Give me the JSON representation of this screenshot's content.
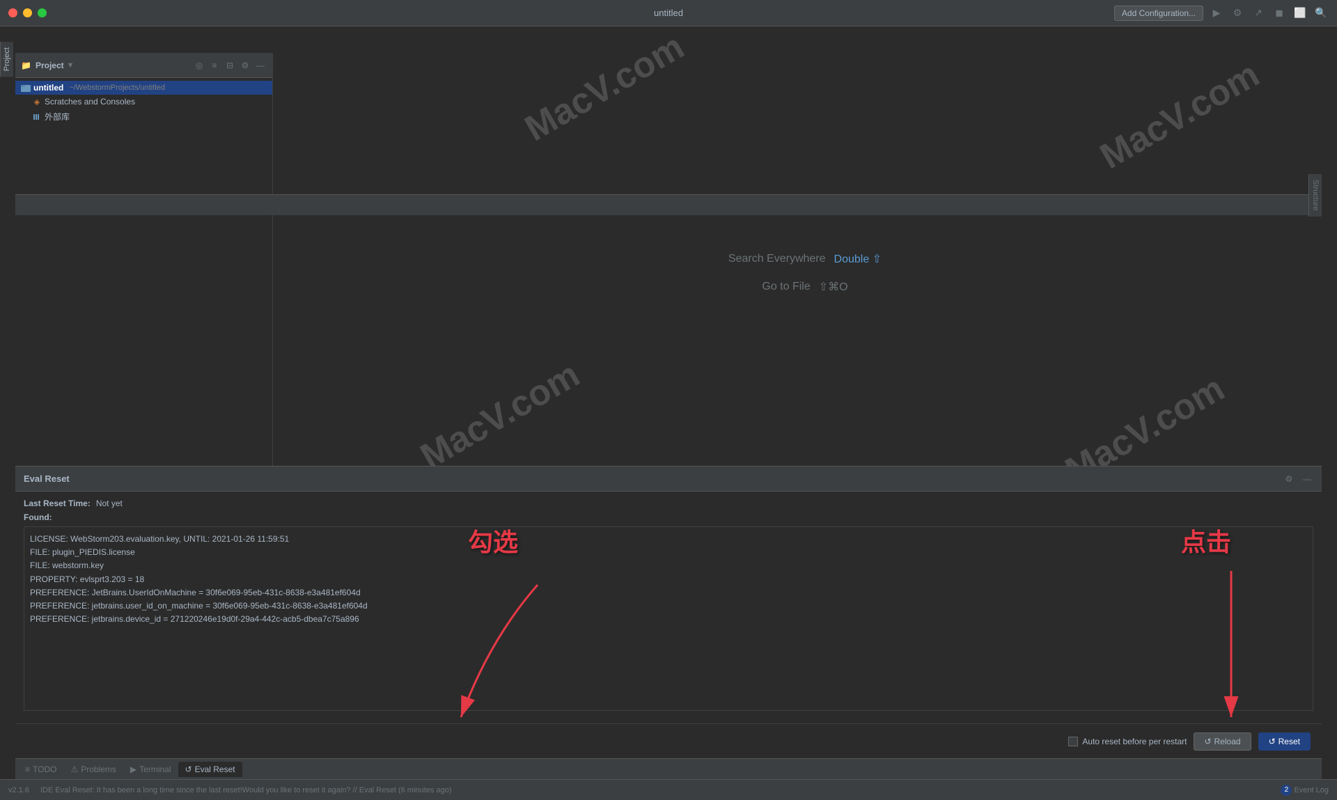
{
  "titlebar": {
    "title": "untitled",
    "add_config_label": "Add Configuration...",
    "traffic": [
      "close",
      "minimize",
      "maximize"
    ]
  },
  "project": {
    "title": "Project",
    "items": [
      {
        "name": "untitled",
        "path": "~/WebstormProjects/untitled",
        "type": "folder",
        "selected": true
      },
      {
        "name": "Scratches and Consoles",
        "path": "",
        "type": "scratch",
        "selected": false
      },
      {
        "name": "外部库",
        "path": "",
        "type": "library",
        "selected": false
      }
    ]
  },
  "editor": {
    "search_everywhere_label": "Search Everywhere",
    "search_shortcut": "Double ⇧",
    "goto_file_label": "Go to File",
    "goto_shortcut": "⇧⌘O"
  },
  "bottom_panel": {
    "title": "Eval Reset",
    "last_reset_label": "Last Reset Time:",
    "last_reset_value": "Not yet",
    "found_label": "Found:",
    "log_lines": [
      "LICENSE: WebStorm203.evaluation.key, UNTIL: 2021-01-26 11:59:51",
      "FILE: plugin_PIEDIS.license",
      "FILE: webstorm.key",
      "PROPERTY: evlsprt3.203 = 18",
      "PREFERENCE: JetBrains.UserIdOnMachine = 30f6e069-95eb-431c-8638-e3a481ef604d",
      "PREFERENCE: jetbrains.user_id_on_machine = 30f6e069-95eb-431c-8638-e3a481ef604d",
      "PREFERENCE: jetbrains.device_id = 271220246e19d0f-29a4-442c-acb5-dbea7c75a896"
    ]
  },
  "actions": {
    "auto_reset_label": "Auto reset before per restart",
    "reload_label": "Reload",
    "reset_label": "Reset"
  },
  "statusbar": {
    "version": "v2.1.6",
    "tabs": [
      {
        "label": "TODO",
        "icon": "≡"
      },
      {
        "label": "Problems",
        "icon": "⚠"
      },
      {
        "label": "Terminal",
        "icon": "▶"
      },
      {
        "label": "Eval Reset",
        "icon": "↺"
      }
    ],
    "event_log_label": "Event Log",
    "event_log_count": "2",
    "bottom_message": "IDE Eval Reset: It has been a long time since the last reset!Would you like to reset it again? // Eval Reset (6 minutes ago)"
  },
  "annotations": {
    "check_label": "勾选",
    "click_label": "点击"
  },
  "watermark": "MacV.com"
}
